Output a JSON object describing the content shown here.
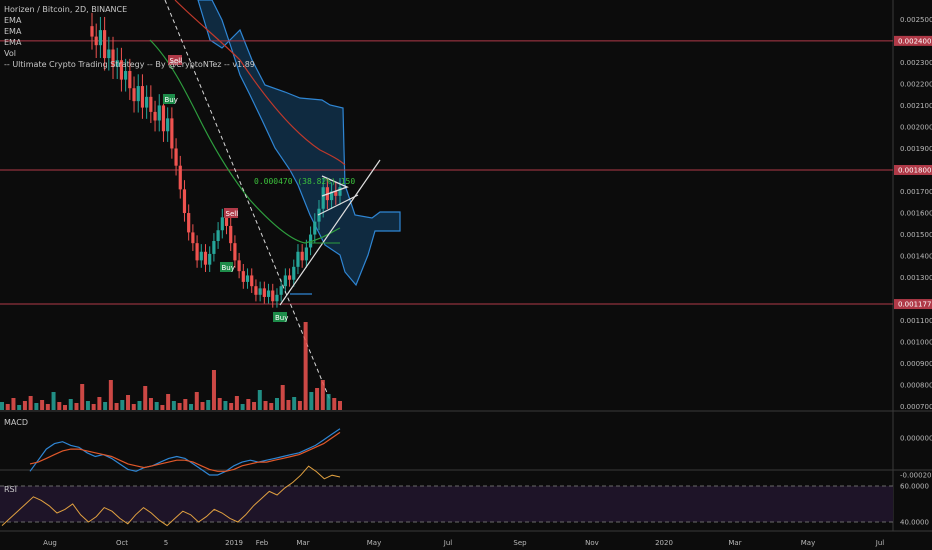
{
  "legend": {
    "symbol": "Horizen / Bitcoin, 2D, BINANCE",
    "ema1": "EMA",
    "ema2": "EMA",
    "ema3": "EMA",
    "vol": "Vol",
    "strategy": "-- Ultimate Crypto Trading Strategy -- By @CryptoNTez -- v1.89"
  },
  "macd_label": "MACD",
  "rsi_label": "RSI",
  "colors": {
    "background": "#0c0c0c",
    "up": "#26a69a",
    "down": "#ef5350",
    "ema_red": "#c0392b",
    "ema_green": "#2e9e3e",
    "cloud_edge": "#2f86d4",
    "cloud_fill": "#0f2a40",
    "level_line": "#b03a48",
    "macd": "#2f86d4",
    "signal": "#e0582a",
    "rsi": "#e0a040",
    "rsi_bg": "#1e1428"
  },
  "price_axis": [
    "0.002500",
    "0.002300",
    "0.002200",
    "0.002100",
    "0.002000",
    "0.001900",
    "0.001700",
    "0.001600",
    "0.001500",
    "0.001400",
    "0.001300",
    "0.001100",
    "0.001000",
    "0.000900",
    "0.000800",
    "0.000700"
  ],
  "price_tags": [
    "0.002400",
    "0.001800",
    "0.001177"
  ],
  "time_axis": [
    "Aug",
    "Oct",
    "5",
    "2019",
    "Feb",
    "Mar",
    "May",
    "Jul",
    "Sep",
    "Nov",
    "2020",
    "Mar",
    "May",
    "Jul"
  ],
  "macd_axis": [
    "0.000000",
    "-0.000200"
  ],
  "rsi_axis": [
    "60.0000",
    "40.0000"
  ],
  "measure_text": "0.000470 (38.82%) 150",
  "signals": [
    {
      "label": "Sell",
      "type": "sell"
    },
    {
      "label": "Buy",
      "type": "buy"
    },
    {
      "label": "Sell",
      "type": "sell"
    },
    {
      "label": "Buy",
      "type": "buy"
    },
    {
      "label": "Buy",
      "type": "buy"
    }
  ],
  "chart_data": {
    "type": "candlestick",
    "title": "Horizen / Bitcoin, 2D, BINANCE",
    "ylim": [
      0.00068,
      0.00259
    ],
    "horizontal_levels": [
      0.0024,
      0.0018,
      0.001177
    ],
    "close": [
      0.00242,
      0.00238,
      0.00245,
      0.00232,
      0.00236,
      0.00228,
      0.00231,
      0.00222,
      0.00226,
      0.00218,
      0.00212,
      0.00219,
      0.00209,
      0.00214,
      0.00207,
      0.00203,
      0.0021,
      0.00198,
      0.00204,
      0.0019,
      0.00182,
      0.00171,
      0.0016,
      0.00151,
      0.00146,
      0.00138,
      0.00142,
      0.00136,
      0.00141,
      0.00147,
      0.00152,
      0.00158,
      0.00154,
      0.00146,
      0.00138,
      0.00133,
      0.00128,
      0.00131,
      0.00126,
      0.00122,
      0.00125,
      0.00121,
      0.00124,
      0.00119,
      0.00122,
      0.00126,
      0.00131,
      0.00129,
      0.00135,
      0.00142,
      0.00138,
      0.00144,
      0.0015,
      0.00156,
      0.00162,
      0.00172,
      0.00166,
      0.0017,
      0.00168,
      0.00172
    ],
    "macd": [
      -0.00018,
      -0.00012,
      -6e-05,
      -3e-05,
      -2e-05,
      -4e-05,
      -5e-05,
      -8e-05,
      -0.0001,
      -9e-05,
      -0.00011,
      -0.00014,
      -0.00017,
      -0.00018,
      -0.00016,
      -0.00015,
      -0.00013,
      -0.00011,
      -0.0001,
      -0.00011,
      -0.00014,
      -0.00017,
      -0.0002,
      -0.0002,
      -0.00018,
      -0.00015,
      -0.00013,
      -0.00012,
      -0.00013,
      -0.00012,
      -0.00011,
      -0.0001,
      -9e-05,
      -8e-05,
      -6e-05,
      -4e-05,
      -1e-05,
      2e-05,
      5e-05
    ],
    "signal_line": [
      -0.00014,
      -0.00013,
      -0.00011,
      -9e-05,
      -7e-05,
      -6e-05,
      -6e-05,
      -7e-05,
      -8e-05,
      -9e-05,
      -0.0001,
      -0.00012,
      -0.00014,
      -0.00015,
      -0.00016,
      -0.00015,
      -0.00014,
      -0.00013,
      -0.00012,
      -0.00012,
      -0.00013,
      -0.00015,
      -0.00017,
      -0.00018,
      -0.00018,
      -0.00017,
      -0.00015,
      -0.00014,
      -0.00013,
      -0.00013,
      -0.00012,
      -0.00011,
      -0.0001,
      -9e-05,
      -7e-05,
      -5e-05,
      -3e-05,
      0.0,
      3e-05
    ],
    "rsi": [
      38,
      42,
      46,
      50,
      54,
      52,
      49,
      45,
      47,
      50,
      44,
      40,
      43,
      48,
      46,
      42,
      39,
      44,
      48,
      45,
      41,
      38,
      42,
      46,
      44,
      40,
      43,
      47,
      45,
      42,
      40,
      44,
      49,
      53,
      57,
      55,
      59,
      62,
      66,
      71,
      68,
      64,
      66,
      65
    ]
  }
}
